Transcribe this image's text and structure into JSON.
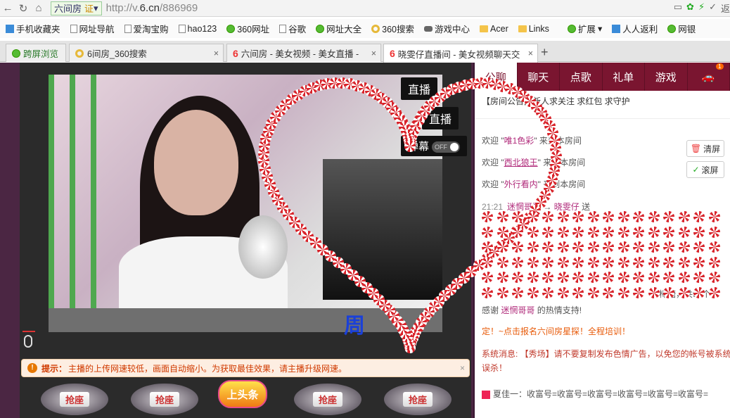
{
  "address": {
    "site_label": "六间房",
    "cert": "证",
    "url_prefix": "http://v.",
    "url_domain": "6.cn",
    "url_path": "/886969",
    "right_text": "返"
  },
  "bookmarks": [
    {
      "label": "手机收藏夹",
      "icon": "phone-icon"
    },
    {
      "label": "网址导航",
      "icon": "doc-icon"
    },
    {
      "label": "爱淘宝购",
      "icon": "doc-icon"
    },
    {
      "label": "hao123",
      "icon": "doc-icon"
    },
    {
      "label": "360网址",
      "icon": "360-icon"
    },
    {
      "label": "谷歌",
      "icon": "doc-icon"
    },
    {
      "label": "网址大全",
      "icon": "360-icon"
    },
    {
      "label": "360搜索",
      "icon": "search-ring-icon"
    },
    {
      "label": "游戏中心",
      "icon": "gamepad-icon"
    },
    {
      "label": "Acer",
      "icon": "folder-icon"
    },
    {
      "label": "Links",
      "icon": "folder-icon"
    },
    {
      "label": "扩展",
      "icon": "grid-icon"
    },
    {
      "label": "人人返利",
      "icon": "rebate-icon"
    },
    {
      "label": "网银",
      "icon": "shield-icon"
    }
  ],
  "tabs": [
    {
      "label": "跨屏浏览"
    },
    {
      "label": "6间房_360搜索"
    },
    {
      "label": "六间房 - 美女视频 - 美女直播 -"
    },
    {
      "label": "晓雯仔直播间 - 美女视频聊天交"
    }
  ],
  "video": {
    "btn_live": "直播",
    "btn_live2": "直播",
    "danmu_label": "弹幕",
    "danmu_toggle": "OFF",
    "strip_text": "周"
  },
  "notice": {
    "title": "提示：",
    "text": "主播的上传网速较低，画面自动缩小。为获取最佳效果，请主播升级网速。"
  },
  "seats": [
    "抢座",
    "抢座",
    "抢座",
    "抢座"
  ],
  "headline": "上头条",
  "right_tabs": [
    {
      "label": "公聊"
    },
    {
      "label": "聊天"
    },
    {
      "label": "点歌"
    },
    {
      "label": "礼单"
    },
    {
      "label": "游戏"
    },
    {
      "label": "",
      "badge": "1"
    }
  ],
  "announcement": "【房间公告】新人求关注 求红包 求守护",
  "chat": {
    "welcome1_pre": "欢迎 \"",
    "welcome1_name": "唯1色彩",
    "welcome1_post": "\" 来到本房间",
    "welcome2_pre": "欢迎 \"",
    "welcome2_name": "西北狼王",
    "welcome2_post": "\" 来到本房间",
    "welcome3_pre": "欢迎 \"",
    "welcome3_name": "外行看内",
    "welcome3_post": "\" 来到本房间",
    "gift_time": "21:21",
    "gift_from": "迷惘哥哥",
    "gift_to": "晓雯仔",
    "gift_verb": "送",
    "gift_tail": "棒棒糖，共99个，",
    "thanks_pre": "感谢 ",
    "thanks_name": "迷惘哥哥",
    "thanks_post": " 的热情支持!",
    "sys1": "定！~点击报名六间房星探！全程培训！",
    "sys2": "系统消息: 【秀场】请不要复制发布色情广告，以免您的帐号被系统误杀！",
    "bottom": "夏佳一：收富号=收富号=收富号=收富号=收富号=收富号="
  },
  "buttons": {
    "clear": "清屏",
    "scroll": "滚屏"
  },
  "colors": {
    "brand": "#7a1530",
    "notice_text": "#d03a00",
    "name": "#b02a7a"
  }
}
